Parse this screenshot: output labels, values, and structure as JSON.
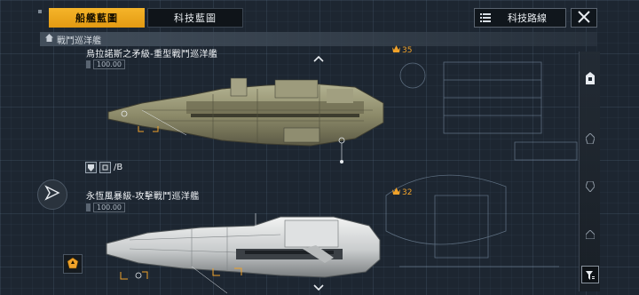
{
  "tabs": {
    "fleet": "船艦藍圖",
    "tech": "科技藍圖"
  },
  "top_right": {
    "route_label": "科技路線"
  },
  "category": {
    "label": "戰鬥巡洋艦"
  },
  "ships": [
    {
      "name": "烏拉諾斯之矛級-重型戰鬥巡洋艦",
      "cost": "100.00",
      "power": "35",
      "level_tag": "/B"
    },
    {
      "name": "永恆風暴級-攻擊戰鬥巡洋艦",
      "cost": "100.00",
      "power": "32"
    }
  ],
  "colors": {
    "accent": "#f5b52a",
    "power": "#f0a22a",
    "background": "#1d2631"
  },
  "icons": {
    "route": "list-icon",
    "close": "close-icon",
    "home": "home-icon",
    "navigate": "navigation-arrow-icon",
    "badge": "fleet-badge-icon",
    "filter": "filter-icon",
    "power": "power-crown-icon",
    "chevron_up": "chevron-up-icon",
    "chevron_down": "chevron-down-icon"
  }
}
